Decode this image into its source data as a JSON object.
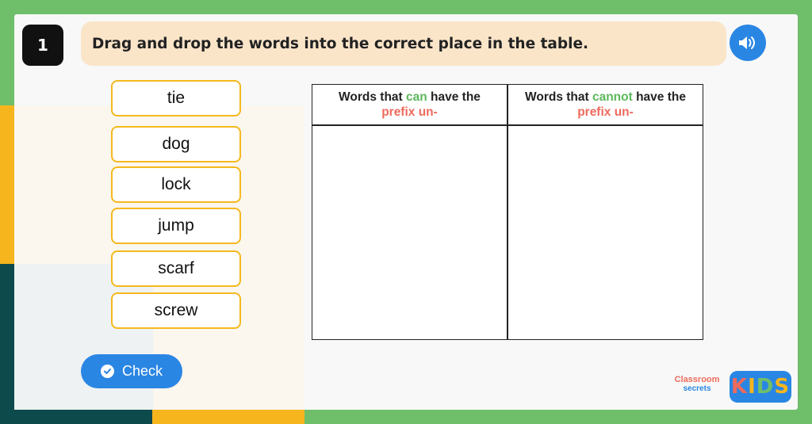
{
  "question": {
    "number": "1",
    "instruction": "Drag and drop the words into the correct place in the table."
  },
  "audio": {
    "icon": "speaker-icon"
  },
  "words": [
    "tie",
    "dog",
    "lock",
    "jump",
    "scarf",
    "screw"
  ],
  "table": {
    "left_header": {
      "pre": "Words that ",
      "highlight": "can",
      "mid": " have the ",
      "prefix": "prefix un-"
    },
    "right_header": {
      "pre": "Words that ",
      "highlight": "cannot",
      "mid": " have the ",
      "prefix": "prefix un-"
    }
  },
  "check_button": {
    "label": "Check",
    "icon": "check-circle-icon"
  },
  "branding": {
    "cs_line1": "Classroom",
    "cs_line2": "secrets",
    "kids": "KIDS"
  },
  "colors": {
    "accent_blue": "#2a86e3",
    "card_border": "#f5b81e",
    "can_green": "#5cb85c",
    "prefix_red": "#ee6a5c",
    "frame_green": "#6fbe6a"
  }
}
